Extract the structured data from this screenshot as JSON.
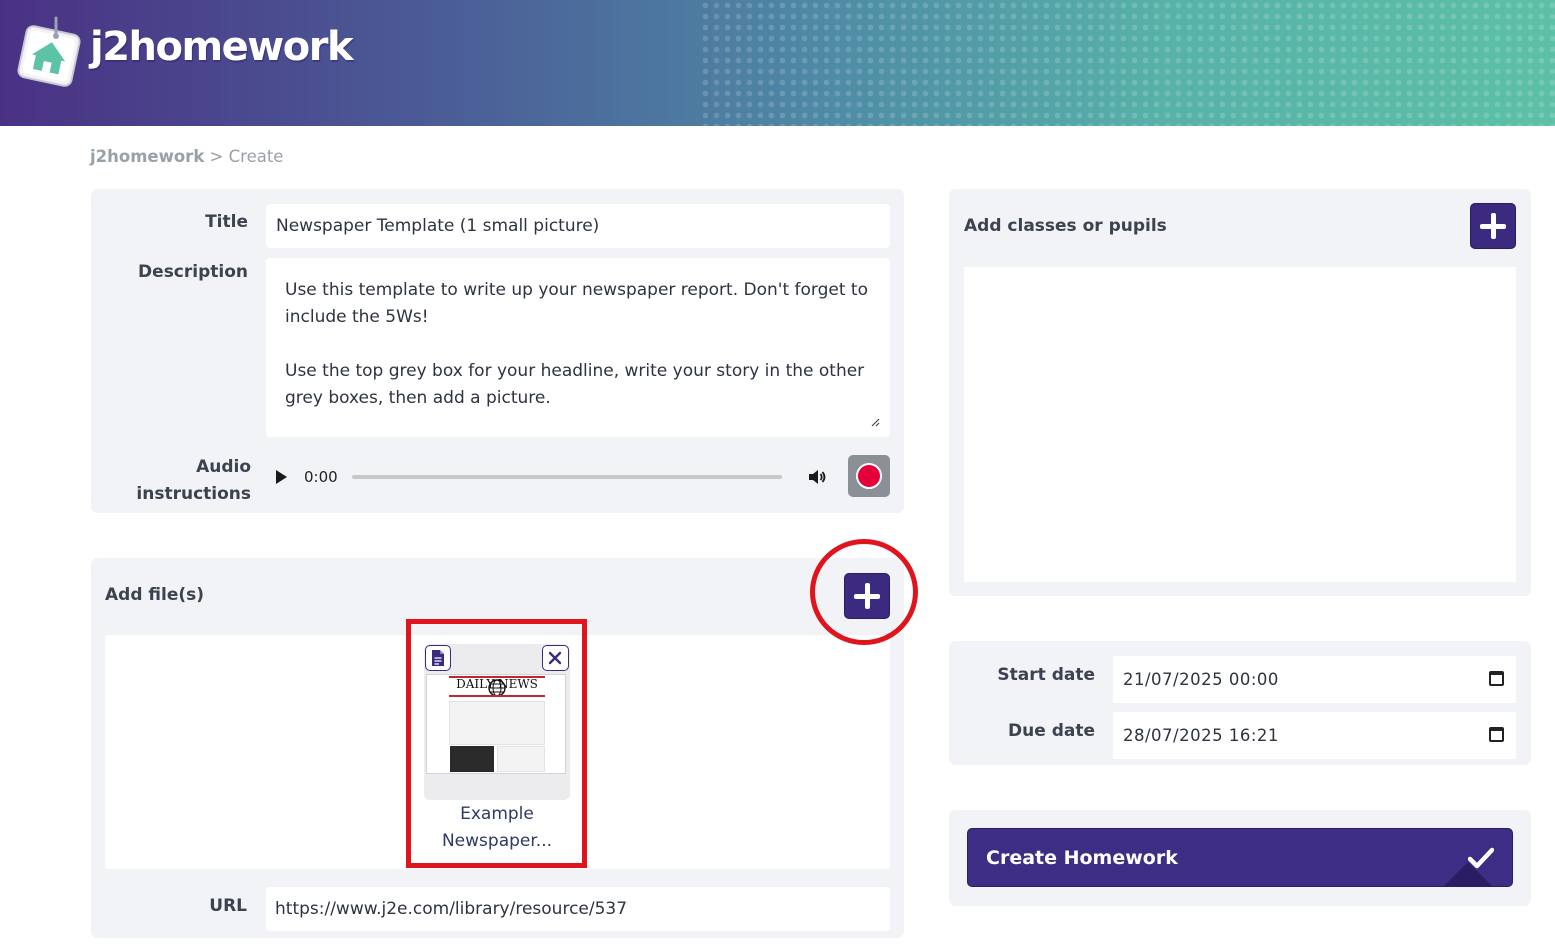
{
  "header": {
    "logo_text": "j2homework"
  },
  "breadcrumb": {
    "root": "j2homework",
    "separator": " > ",
    "current": "Create"
  },
  "form": {
    "title_label": "Title",
    "title_value": "Newspaper Template (1 small picture)",
    "description_label": "Description",
    "description_value": "Use this template to write up your newspaper report. Don't forget to include the 5Ws!\n\nUse the top grey box for your headline, write your story in the other grey boxes, then add a picture.",
    "audio_label_line1": "Audio",
    "audio_label_line2": "instructions",
    "audio_time": "0:00"
  },
  "files": {
    "header": "Add file(s)",
    "items": [
      {
        "name_line1": "Example",
        "name_line2": "Newspaper...",
        "thumbnail_masthead": "DAILY NEWS"
      }
    ],
    "url_label": "URL",
    "url_value": "https://www.j2e.com/library/resource/537"
  },
  "classes": {
    "header": "Add classes or pupils"
  },
  "dates": {
    "start_label": "Start date",
    "start_value": "21/07/2025 00:00",
    "due_label": "Due date",
    "due_value": "28/07/2025 16:21"
  },
  "create": {
    "label": "Create Homework"
  },
  "colors": {
    "brand_purple": "#3b2a80",
    "record_red": "#e5003a",
    "annotation_red": "#e0141d",
    "panel_bg": "#f2f3f6"
  },
  "icons": [
    "logo-icon",
    "play-icon",
    "volume-icon",
    "record-icon",
    "plus-icon",
    "document-icon",
    "close-icon",
    "calendar-icon",
    "checkmark-icon"
  ]
}
